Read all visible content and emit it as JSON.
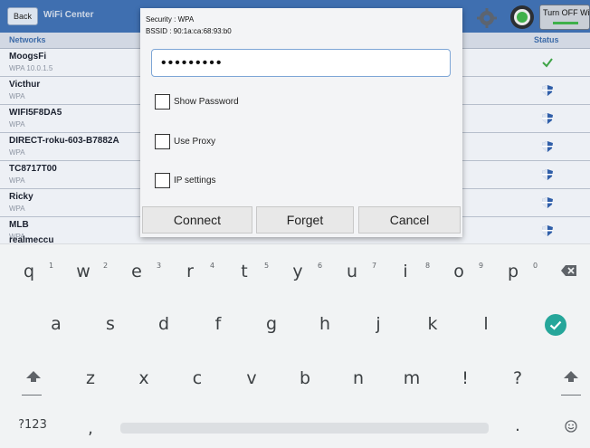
{
  "app": {
    "back_label": "Back",
    "title": "WiFi Center",
    "turn_off_label": "Turn OFF WiFi",
    "col_networks": "Networks",
    "col_status": "Status",
    "networks": [
      {
        "ssid": "MoogsFi",
        "security": "WPA   10.0.1.5",
        "status_icon": "checkmark-icon"
      },
      {
        "ssid": "Victhur",
        "security": "WPA",
        "status_icon": "shield-icon"
      },
      {
        "ssid": "WIFI5F8DA5",
        "security": "WPA",
        "status_icon": "shield-icon"
      },
      {
        "ssid": "DIRECT-roku-603-B7882A",
        "security": "WPA",
        "status_icon": "shield-icon"
      },
      {
        "ssid": "TC8717T00",
        "security": "WPA",
        "status_icon": "shield-icon"
      },
      {
        "ssid": "Ricky",
        "security": "WPA",
        "status_icon": "shield-icon"
      },
      {
        "ssid": "MLB",
        "security": "WPA",
        "status_icon": "shield-icon"
      }
    ],
    "partial_row_ssid": "realmeccu"
  },
  "dialog": {
    "security": "Security : WPA",
    "bssid": "BSSID : 90:1a:ca:68:93:b0",
    "password_value": "•••••••••",
    "options": [
      {
        "label": "Show Password",
        "checked": false
      },
      {
        "label": "Use Proxy",
        "checked": false
      },
      {
        "label": "IP settings",
        "checked": false
      }
    ],
    "connect_label": "Connect",
    "forget_label": "Forget",
    "cancel_label": "Cancel"
  },
  "keyboard": {
    "row1": [
      {
        "key": "q",
        "hint": "1"
      },
      {
        "key": "w",
        "hint": "2"
      },
      {
        "key": "e",
        "hint": "3"
      },
      {
        "key": "r",
        "hint": "4"
      },
      {
        "key": "t",
        "hint": "5"
      },
      {
        "key": "y",
        "hint": "6"
      },
      {
        "key": "u",
        "hint": "7"
      },
      {
        "key": "i",
        "hint": "8"
      },
      {
        "key": "o",
        "hint": "9"
      },
      {
        "key": "p",
        "hint": "0"
      }
    ],
    "row2": [
      "a",
      "s",
      "d",
      "f",
      "g",
      "h",
      "j",
      "k",
      "l"
    ],
    "row3": [
      "z",
      "x",
      "c",
      "v",
      "b",
      "n",
      "m",
      "!",
      "?"
    ],
    "symbols_label": "?123",
    "comma": ",",
    "period": ".",
    "colors": {
      "enter": "#26a69a",
      "wifi_bar": "#3fb04a",
      "topbar": "#3f6fb0"
    }
  }
}
